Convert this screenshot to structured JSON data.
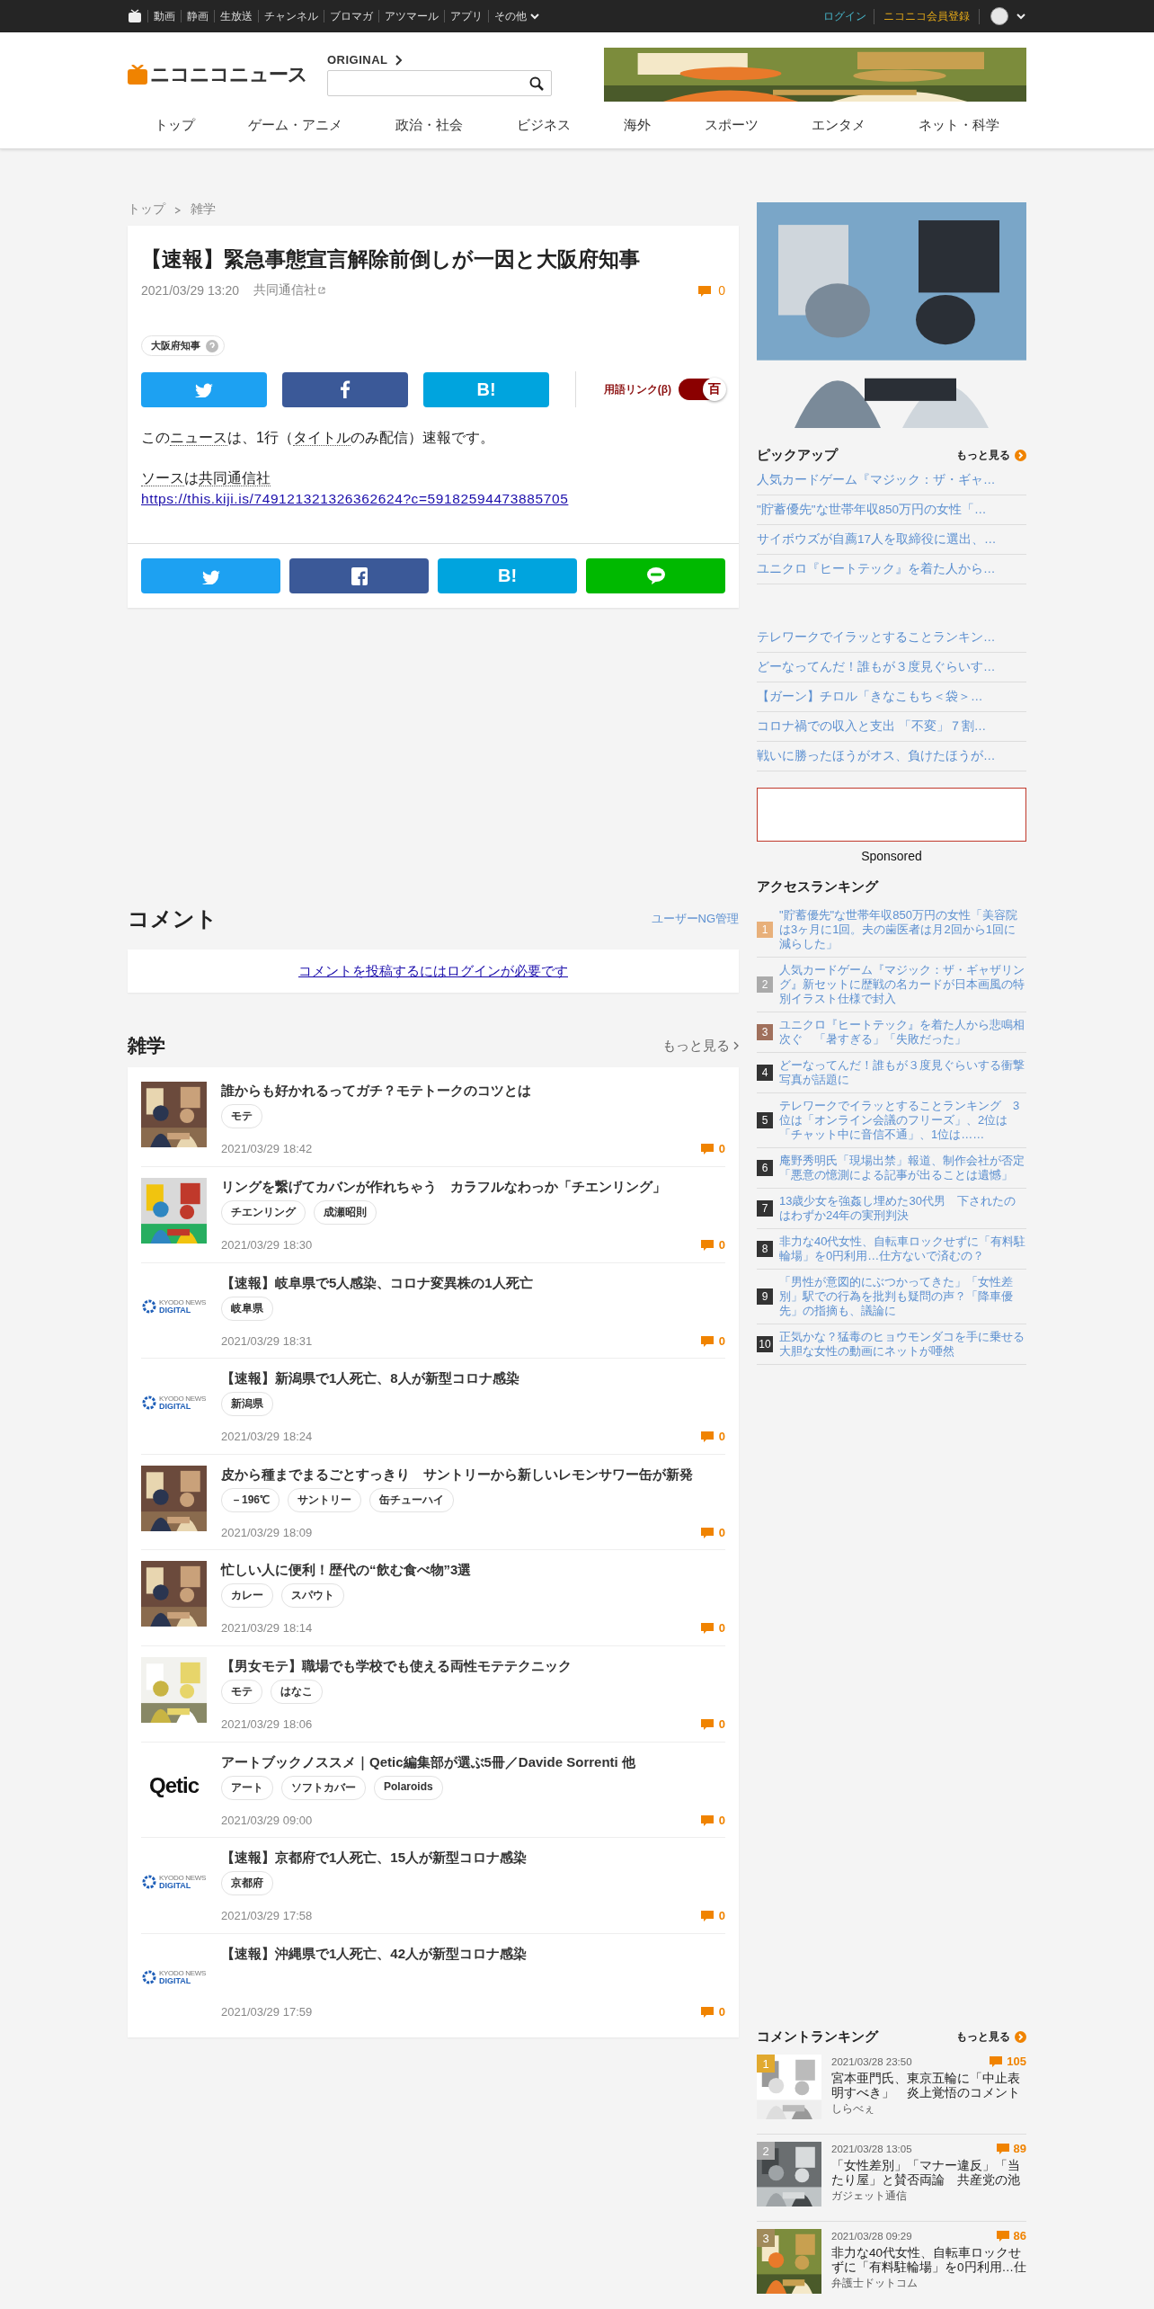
{
  "top_bar": {
    "services": [
      "動画",
      "静画",
      "生放送",
      "チャンネル",
      "ブロマガ",
      "アツマール",
      "アプリ",
      "その他"
    ],
    "login": "ログイン",
    "register": "ニコニコ会員登録"
  },
  "header": {
    "logo": "ニコニコニュース",
    "original_link": "ORIGINAL"
  },
  "nav": [
    "トップ",
    "ゲーム・アニメ",
    "政治・社会",
    "ビジネス",
    "海外",
    "スポーツ",
    "エンタメ",
    "ネット・科学"
  ],
  "breadcrumb": [
    "トップ",
    "雑学"
  ],
  "article": {
    "title": "【速報】緊急事態宣言解除前倒しが一因と大阪府知事",
    "date": "2021/03/29 13:20",
    "source": "共同通信社",
    "comment_count": "0",
    "tags": [
      "大阪府知事"
    ],
    "share_top": [
      {
        "kind": "twitter"
      },
      {
        "kind": "facebook"
      },
      {
        "kind": "hatena",
        "label": "B!"
      }
    ],
    "term_link": {
      "label": "用語リンク(β)",
      "knob": "百",
      "on": true
    },
    "body": [
      [
        {
          "text": "この"
        },
        {
          "text": "ニュース",
          "term": true
        },
        {
          "text": "は、1行（"
        },
        {
          "text": "タイトル",
          "term": true
        },
        {
          "text": "のみ配信）速報です。"
        }
      ],
      [
        {
          "text": "ソース",
          "term": true
        },
        {
          "text": "は"
        },
        {
          "text": "共同通信社",
          "term": true
        }
      ]
    ],
    "url": "https://this.kiji.is/749121321326362624?c=59182594473885705",
    "share_bottom": [
      {
        "kind": "twitter"
      },
      {
        "kind": "facebook"
      },
      {
        "kind": "hatena",
        "label": "B!"
      },
      {
        "kind": "line"
      }
    ]
  },
  "comments": {
    "title": "コメント",
    "ng_link": "ユーザーNG管理",
    "login_prompt": "コメントを投稿するにはログインが必要です"
  },
  "category": {
    "title": "雑学",
    "more": "もっと見る",
    "items": [
      {
        "thumb": {
          "kind": "picture"
        },
        "title": "誰からも好かれるってガチ？モテトークのコツとは",
        "tags": [
          "モテ"
        ],
        "date": "2021/03/29 18:42",
        "comments": "0"
      },
      {
        "thumb": {
          "kind": "picture"
        },
        "title": "リングを繋げてカバンが作れちゃう　カラフルなわっか「チエンリング」",
        "tags": [
          "チエンリング",
          "成瀬昭則"
        ],
        "date": "2021/03/29 18:30",
        "comments": "0"
      },
      {
        "thumb": {
          "kind": "ringlogo",
          "lines": [
            "KYODO NEWS",
            "DIGITAL"
          ]
        },
        "title": "【速報】岐阜県で5人感染、コロナ変異株の1人死亡",
        "tags": [
          "岐阜県"
        ],
        "date": "2021/03/29 18:31",
        "comments": "0"
      },
      {
        "thumb": {
          "kind": "ringlogo",
          "lines": [
            "KYODO NEWS",
            "DIGITAL"
          ]
        },
        "title": "【速報】新潟県で1人死亡、8人が新型コロナ感染",
        "tags": [
          "新潟県"
        ],
        "date": "2021/03/29 18:24",
        "comments": "0"
      },
      {
        "thumb": {
          "kind": "picture"
        },
        "title": "皮から種までまるごとすっきり　サントリーから新しいレモンサワー缶が新発",
        "tags": [
          "－196℃",
          "サントリー",
          "缶チューハイ"
        ],
        "date": "2021/03/29 18:09",
        "comments": "0"
      },
      {
        "thumb": {
          "kind": "picture"
        },
        "title": "忙しい人に便利！歴代の“飲む食べ物”3選",
        "tags": [
          "カレー",
          "スパウト"
        ],
        "date": "2021/03/29 18:14",
        "comments": "0"
      },
      {
        "thumb": {
          "kind": "picture"
        },
        "title": "【男女モテ】職場でも学校でも使える両性モテテクニック",
        "tags": [
          "モテ",
          "はなこ"
        ],
        "date": "2021/03/29 18:06",
        "comments": "0"
      },
      {
        "thumb": {
          "kind": "wordmark",
          "lines": [
            "Qetic"
          ]
        },
        "title": "アートブックノススメ｜Qetic編集部が選ぶ5冊／Davide Sorrenti 他",
        "tags": [
          "アート",
          "ソフトカバー",
          "Polaroids"
        ],
        "date": "2021/03/29 09:00",
        "comments": "0"
      },
      {
        "thumb": {
          "kind": "ringlogo",
          "lines": [
            "KYODO NEWS",
            "DIGITAL"
          ]
        },
        "title": "【速報】京都府で1人死亡、15人が新型コロナ感染",
        "tags": [
          "京都府"
        ],
        "date": "2021/03/29 17:58",
        "comments": "0"
      },
      {
        "thumb": {
          "kind": "ringlogo",
          "lines": [
            "KYODO NEWS",
            "DIGITAL"
          ]
        },
        "title": "【速報】沖縄県で1人死亡、42人が新型コロナ感染",
        "date": "2021/03/29 17:59",
        "comments": "0"
      }
    ]
  },
  "pickup": {
    "title": "ピックアップ",
    "more": "もっと見る",
    "groups": [
      [
        "人気カードゲーム『マジック：ザ・ギャ…",
        "\"貯蓄優先\"な世帯年収850万円の女性「…",
        "サイボウズが自薦17人を取締役に選出、…",
        "ユニクロ『ヒートテック』を着た人から…"
      ],
      [
        "テレワークでイラッとすることランキン…",
        "どーなってんだ！誰もが３度見ぐらいす…",
        "【ガーン】チロル「きなこもち＜袋＞…",
        "コロナ禍での収入と支出 「不変」７割…",
        "戦いに勝ったほうがオス、負けたほうが…"
      ]
    ]
  },
  "sponsored": "Sponsored",
  "access_ranking": {
    "title": "アクセスランキング",
    "items": [
      {
        "rank": "1",
        "color": "#e8b07a",
        "title": "\"貯蓄優先\"な世帯年収850万円の女性「美容院は3ヶ月に1回。夫の歯医者は月2回から1回に減らした」"
      },
      {
        "rank": "2",
        "color": "#aaaaaa",
        "title": "人気カードゲーム『マジック：ザ・ギャザリング』新セットに歴戦の名カードが日本画風の特別イラスト仕様で封入"
      },
      {
        "rank": "3",
        "color": "#a0705c",
        "title": "ユニクロ『ヒートテック』を着た人から悲鳴相次ぐ　「暑すぎる」「失敗だった」"
      },
      {
        "rank": "4",
        "color": "#333333",
        "title": "どーなってんだ！誰もが３度見ぐらいする衝撃写真が話題に"
      },
      {
        "rank": "5",
        "color": "#333333",
        "title": "テレワークでイラッとすることランキング　3位は「オンライン会議のフリーズ」、2位は「チャット中に音信不通」、1位は……"
      },
      {
        "rank": "6",
        "color": "#333333",
        "title": "庵野秀明氏「現場出禁」報道、制作会社が否定「悪意の憶測による記事が出ることは遺憾」"
      },
      {
        "rank": "7",
        "color": "#333333",
        "title": "13歳少女を強姦し埋めた30代男　下されたのはわずか24年の実刑判決"
      },
      {
        "rank": "8",
        "color": "#333333",
        "title": "非力な40代女性、自転車ロックせずに「有料駐輪場」を0円利用…仕方ないで済むの？"
      },
      {
        "rank": "9",
        "color": "#333333",
        "title": "「男性が意図的にぶつかってきた」「女性差別」駅での行為を批判も疑問の声？「降車優先」の指摘も、議論に"
      },
      {
        "rank": "10",
        "color": "#333333",
        "title": "正気かな？猛毒のヒョウモンダコを手に乗せる大胆な女性の動画にネットが唖然"
      }
    ]
  },
  "comment_ranking": {
    "title": "コメントランキング",
    "more": "もっと見る",
    "items": [
      {
        "rank": "1",
        "color": "#e1a92f",
        "date": "2021/03/28 23:50",
        "count": "105",
        "title": "宮本亜門氏、東京五輪に「中止表明すべき」　炎上覚悟のコメント",
        "source": "しらべぇ"
      },
      {
        "rank": "2",
        "color": "#aaaaaa",
        "date": "2021/03/28 13:05",
        "count": "89",
        "title": "「女性差別」「マナー違反」「当たり屋」と賛否両論　共産党の池",
        "source": "ガジェット通信"
      },
      {
        "rank": "3",
        "color": "#a08a5a",
        "date": "2021/03/28 09:29",
        "count": "86",
        "title": "非力な40代女性、自転車ロックせずに「有料駐輪場」を0円利用…仕",
        "source": "弁護士ドットコム"
      }
    ]
  }
}
